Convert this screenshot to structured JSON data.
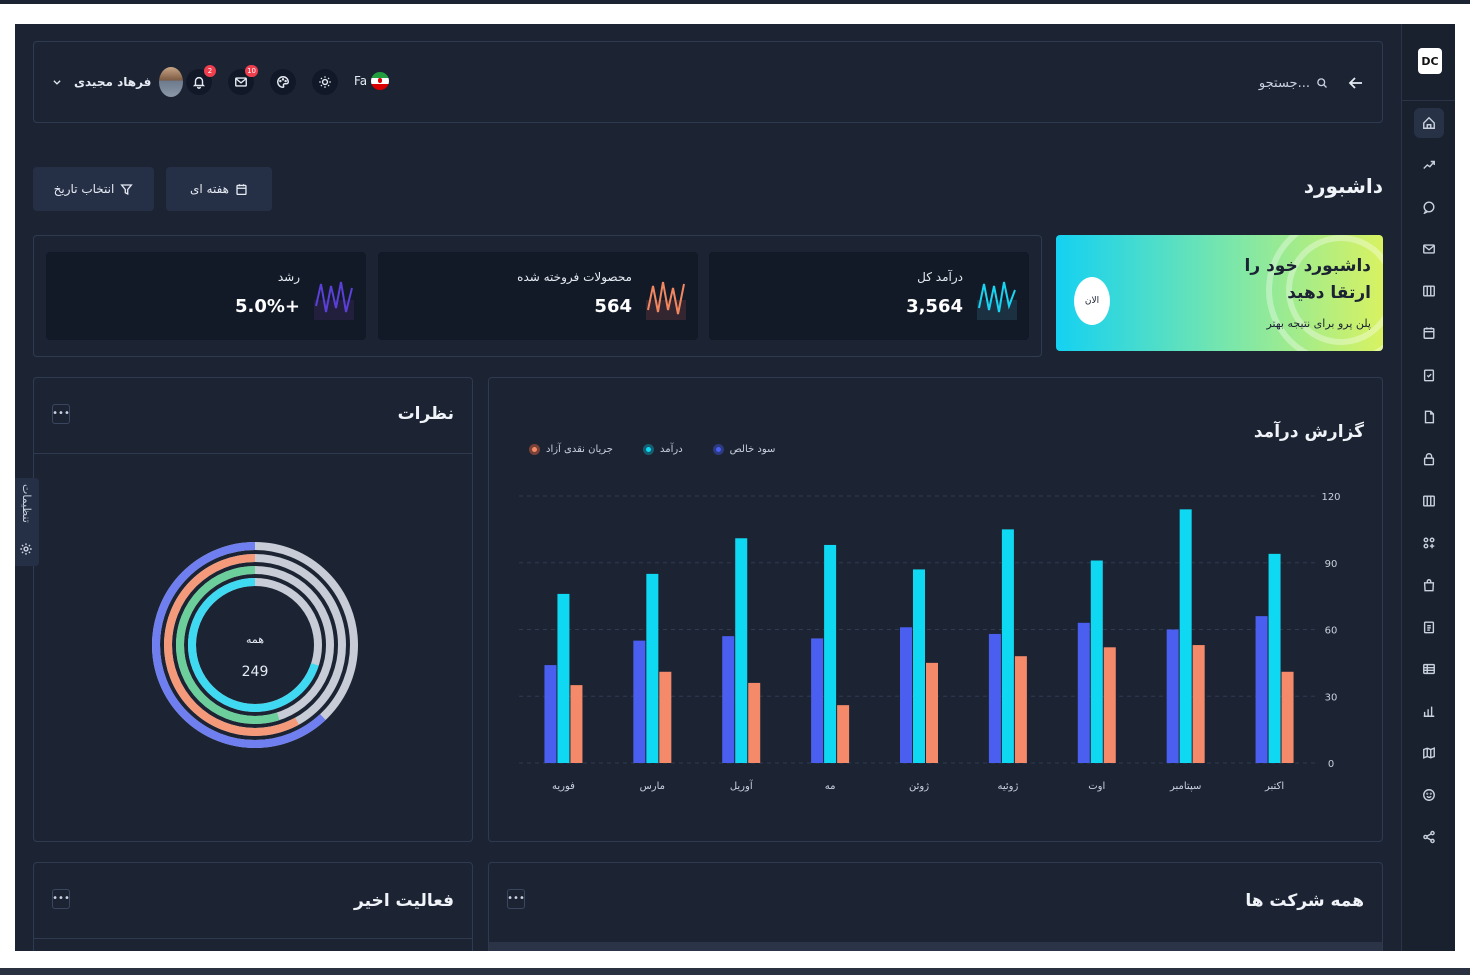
{
  "app": {
    "logo": "DC"
  },
  "topbar": {
    "search_placeholder": "جستجو...",
    "language": "Fa",
    "user_name": "فرهاد مجیدی",
    "notifications_count": "2",
    "messages_count": "10"
  },
  "page": {
    "title": "داشبورد"
  },
  "toolbar": {
    "date_button": "انتخاب تاریخ",
    "period_button": "هفته ای"
  },
  "promo": {
    "title": "داشبورد خود را ارتقا دهید",
    "subtitle": "پلن پرو برای نتیجه بهتر",
    "button": "الان"
  },
  "stats": [
    {
      "label": "درآمد کل",
      "value": "3,564",
      "color": "#18d4f0"
    },
    {
      "label": "محصولات فروخته شده",
      "value": "564",
      "color": "#f2875f"
    },
    {
      "label": "رشد",
      "value": "5.0%+",
      "color": "#5b3fd9"
    }
  ],
  "revenue_card": {
    "title": "گزارش درآمد"
  },
  "reviews_card": {
    "title": "نظرات",
    "center_label": "همه",
    "center_value": "249"
  },
  "activity_card": {
    "title": "فعالیت اخیر"
  },
  "companies_card": {
    "title": "همه شرکت ها"
  },
  "settings_tab": {
    "label": "تنظیمات"
  },
  "colors": {
    "profit": "#4a5ef0",
    "revenue": "#0fd9f2",
    "cashflow": "#f58a6a",
    "bg": "#1c2434"
  },
  "chart_data": {
    "type": "bar",
    "categories": [
      "فوریه",
      "مارس",
      "آوریل",
      "مه",
      "ژوئن",
      "ژوئیه",
      "اوت",
      "سپتامبر",
      "اکتبر"
    ],
    "series": [
      {
        "name": "سود خالص",
        "values": [
          44,
          55,
          57,
          56,
          61,
          58,
          63,
          60,
          66
        ]
      },
      {
        "name": "درآمد",
        "values": [
          76,
          85,
          101,
          98,
          87,
          105,
          91,
          114,
          94
        ]
      },
      {
        "name": "جریان نقدی آزاد",
        "values": [
          35,
          41,
          36,
          26,
          45,
          48,
          52,
          53,
          41
        ]
      }
    ],
    "yticks": [
      "0",
      "30",
      "60",
      "90",
      "120"
    ],
    "ylim": [
      0,
      120
    ],
    "legend_position": "top-left",
    "grid": true
  },
  "reviews_rings": [
    {
      "color": "#6f7ff0",
      "value": 0.62
    },
    {
      "color": "#f49a7a",
      "value": 0.58
    },
    {
      "color": "#6ccf9b",
      "value": 0.55
    },
    {
      "color": "#3fd9f2",
      "value": 0.7
    }
  ]
}
